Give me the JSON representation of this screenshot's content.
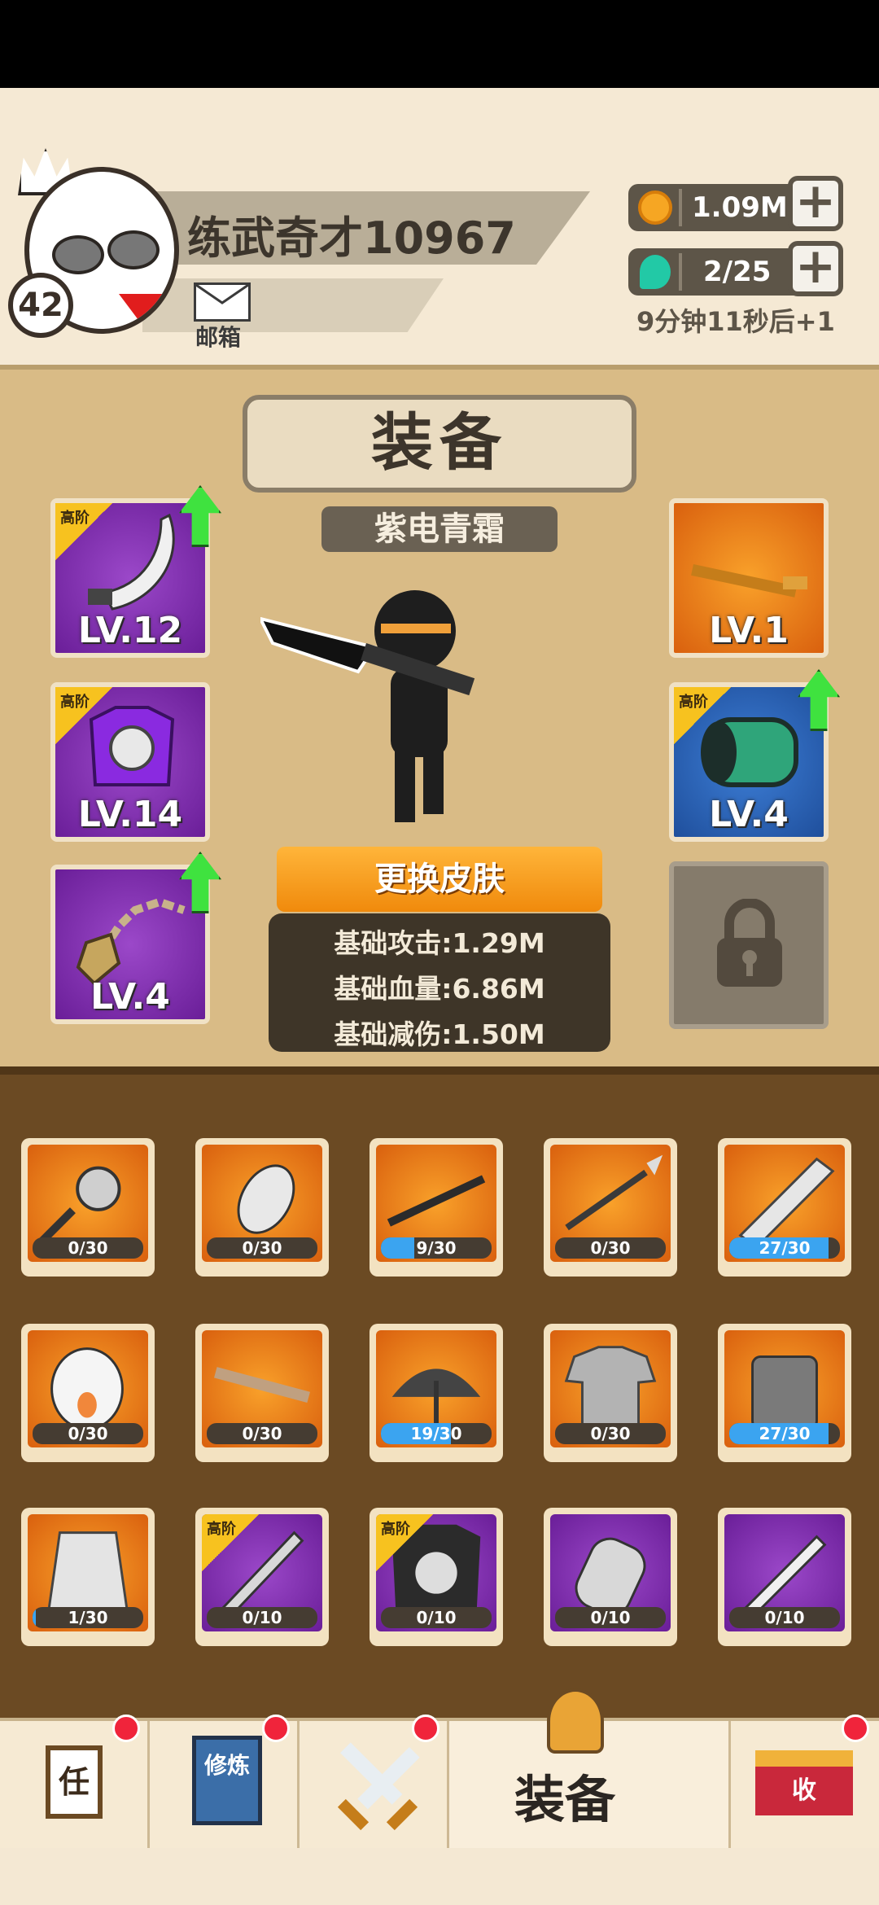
{
  "player": {
    "name": "练武奇才10967",
    "level": "42",
    "mail_label": "邮箱"
  },
  "resources": {
    "coins": "1.09M",
    "energy": "2/25",
    "energy_timer": "9分钟11秒后+1"
  },
  "equipment": {
    "title": "装备",
    "skin_name": "紫电青霜",
    "change_skin_button": "更换皮肤",
    "left_slots": [
      {
        "tag": "高阶",
        "level": "LV.12",
        "color": "purple",
        "upgrade": true
      },
      {
        "tag": "高阶",
        "level": "LV.14",
        "color": "purple",
        "upgrade": false
      },
      {
        "tag": "",
        "level": "LV.4",
        "color": "purple",
        "upgrade": true
      }
    ],
    "right_slots": [
      {
        "tag": "",
        "level": "LV.1",
        "color": "orange",
        "upgrade": false
      },
      {
        "tag": "高阶",
        "level": "LV.4",
        "color": "blue",
        "upgrade": true
      }
    ],
    "stats": [
      "基础攻击:1.29M",
      "基础血量:6.86M",
      "基础减伤:1.50M"
    ]
  },
  "inventory": [
    {
      "tag": "",
      "progress": "0/30",
      "fill": 0.0,
      "color": "orange",
      "icon": "mace-icon"
    },
    {
      "tag": "",
      "progress": "0/30",
      "fill": 0.0,
      "color": "orange",
      "icon": "chicken-icon"
    },
    {
      "tag": "",
      "progress": "9/30",
      "fill": 0.3,
      "color": "orange",
      "icon": "staff-icon"
    },
    {
      "tag": "",
      "progress": "0/30",
      "fill": 0.0,
      "color": "orange",
      "icon": "spear-icon"
    },
    {
      "tag": "",
      "progress": "27/30",
      "fill": 0.9,
      "color": "orange",
      "icon": "broadsword-icon"
    },
    {
      "tag": "",
      "progress": "0/30",
      "fill": 0.0,
      "color": "orange",
      "icon": "mask-icon"
    },
    {
      "tag": "",
      "progress": "0/30",
      "fill": 0.0,
      "color": "orange",
      "icon": "key-sword-icon"
    },
    {
      "tag": "",
      "progress": "19/30",
      "fill": 0.63,
      "color": "orange",
      "icon": "umbrella-icon"
    },
    {
      "tag": "",
      "progress": "0/30",
      "fill": 0.0,
      "color": "orange",
      "icon": "tshirt-icon"
    },
    {
      "tag": "",
      "progress": "27/30",
      "fill": 0.9,
      "color": "orange",
      "icon": "armor-icon"
    },
    {
      "tag": "",
      "progress": "1/30",
      "fill": 0.03,
      "color": "orange",
      "icon": "robe-icon"
    },
    {
      "tag": "高阶",
      "progress": "0/10",
      "fill": 0.0,
      "color": "purple",
      "icon": "sword-icon"
    },
    {
      "tag": "高阶",
      "progress": "0/10",
      "fill": 0.0,
      "color": "purple",
      "icon": "chestplate-icon"
    },
    {
      "tag": "",
      "progress": "0/10",
      "fill": 0.0,
      "color": "purple",
      "icon": "gauntlet-icon"
    },
    {
      "tag": "",
      "progress": "0/10",
      "fill": 0.0,
      "color": "purple",
      "icon": "serrated-sword-icon"
    }
  ],
  "nav": {
    "tasks_icon_char": "任",
    "cultivate_icon_char": "修炼",
    "equipment_label": "装备",
    "collect_icon_char": "收"
  },
  "colors": {
    "header_bg": "#f5e9d4",
    "panel_bg": "#d9bb86",
    "inventory_bg": "#6b4a23",
    "orange_rarity": "#f08a0c",
    "purple_rarity": "#7b2cae",
    "progress_blue": "#3ba4f0",
    "upgrade_green": "#3fe23f"
  }
}
